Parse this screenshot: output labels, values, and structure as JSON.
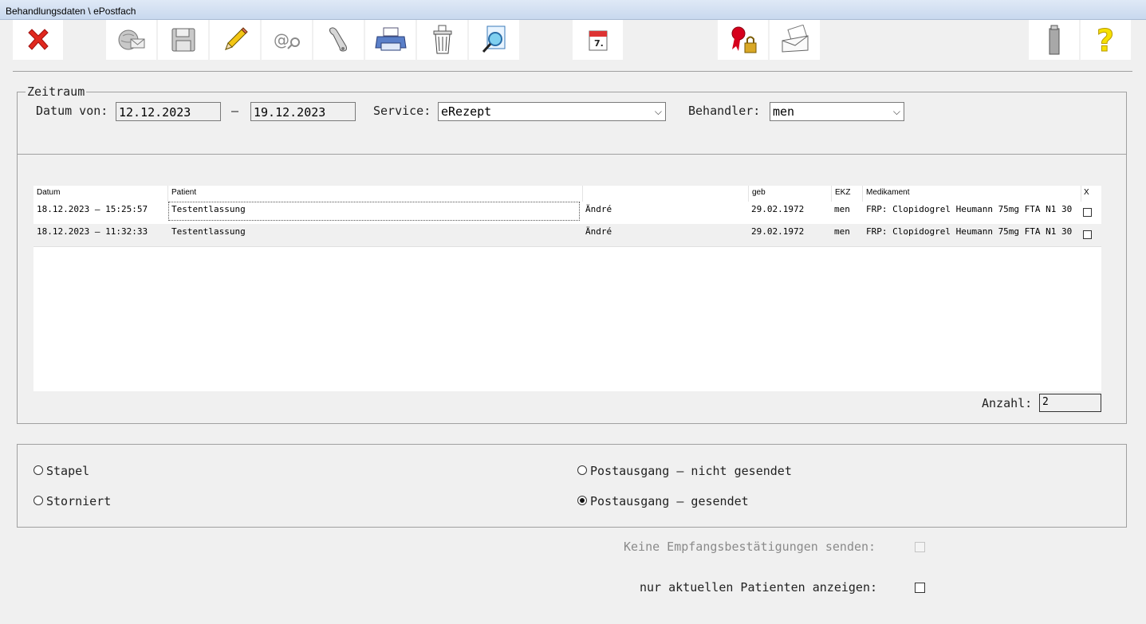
{
  "window": {
    "title": "Behandlungsdaten \\ ePostfach"
  },
  "toolbar": {
    "buttons": [
      {
        "icon": "close-x-icon"
      },
      {
        "icon": "globe-mail-icon"
      },
      {
        "icon": "floppy-disk-icon"
      },
      {
        "icon": "pencil-icon"
      },
      {
        "icon": "at-search-icon"
      },
      {
        "icon": "barcode-scanner-icon"
      },
      {
        "icon": "printer-icon"
      },
      {
        "icon": "trash-bin-icon"
      },
      {
        "icon": "document-search-icon"
      },
      {
        "icon": "calendar-icon"
      },
      {
        "icon": "certificate-lock-icon"
      },
      {
        "icon": "letters-icon"
      },
      {
        "icon": "info-device-icon"
      },
      {
        "icon": "help-question-icon"
      }
    ]
  },
  "zeitraum": {
    "legend": "Zeitraum",
    "datum_von_label": "Datum von:",
    "date_from": "12.12.2023",
    "dash": "–",
    "date_to": "19.12.2023",
    "service_label": "Service:",
    "service_value": "eRezept",
    "behandler_label": "Behandler:",
    "behandler_value": "men"
  },
  "table": {
    "headers": {
      "datum": "Datum",
      "patient": "Patient",
      "geb": "geb",
      "ekz": "EKZ",
      "medikament": "Medikament",
      "x": "X"
    },
    "rows": [
      {
        "datum": "18.12.2023 – 15:25:57",
        "patient": "Testentlassung",
        "vorname": "Ändré",
        "geb": "29.02.1972",
        "ekz": "men",
        "medikament": "FRP: Clopidogrel Heumann 75mg FTA N1 30",
        "checked": false
      },
      {
        "datum": "18.12.2023 – 11:32:33",
        "patient": "Testentlassung",
        "vorname": "Ändré",
        "geb": "29.02.1972",
        "ekz": "men",
        "medikament": "FRP: Clopidogrel Heumann 75mg FTA N1 30",
        "checked": false
      }
    ],
    "anzahl_label": "Anzahl:",
    "anzahl_value": "2"
  },
  "filter": {
    "stapel": "Stapel",
    "storniert": "Storniert",
    "postausgang_nicht": "Postausgang – nicht gesendet",
    "postausgang_gesendet": "Postausgang – gesendet",
    "selected": "postausgang_gesendet"
  },
  "options": {
    "keine_empfang_label": "Keine Empfangsbestätigungen senden:",
    "nur_aktuellen_label": "nur aktuellen Patienten anzeigen:"
  }
}
